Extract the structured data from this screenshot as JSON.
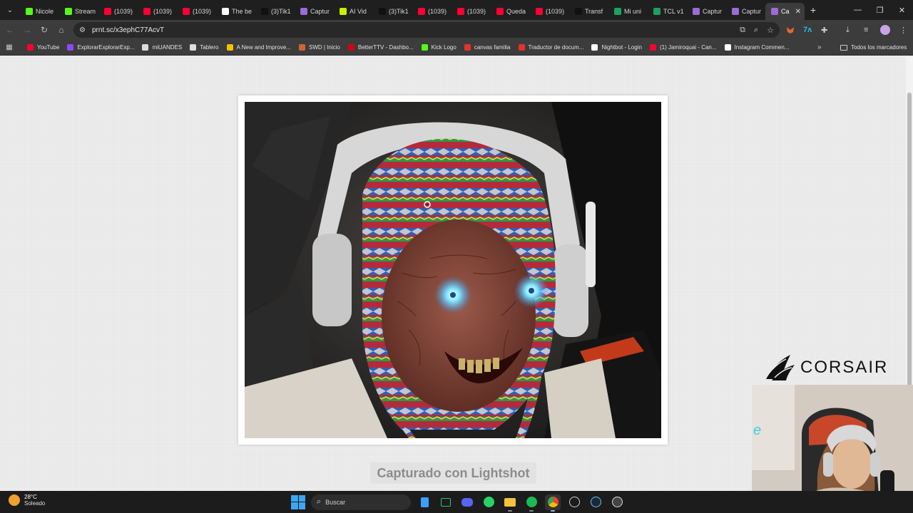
{
  "browser": {
    "tabs": [
      {
        "label": "Nicole",
        "color": "#53fc18"
      },
      {
        "label": "Stream",
        "color": "#53fc18"
      },
      {
        "label": "(1039)",
        "color": "#ff0033"
      },
      {
        "label": "(1039)",
        "color": "#ff0033"
      },
      {
        "label": "(1039)",
        "color": "#ff0033"
      },
      {
        "label": "The be",
        "color": "#ffffff"
      },
      {
        "label": "(3)Tik1",
        "color": "#111111"
      },
      {
        "label": "Captur",
        "color": "#9b6bd6"
      },
      {
        "label": "AI Vid",
        "color": "#c7f000"
      },
      {
        "label": "(3)Tik1",
        "color": "#111111"
      },
      {
        "label": "(1039)",
        "color": "#ff0033"
      },
      {
        "label": "(1039)",
        "color": "#ff0033"
      },
      {
        "label": "Queda",
        "color": "#ff0033"
      },
      {
        "label": "(1039)",
        "color": "#ff0033"
      },
      {
        "label": "Transf",
        "color": "#111111"
      },
      {
        "label": "Mi uni",
        "color": "#1aa260"
      },
      {
        "label": "TCL v1",
        "color": "#1aa260"
      },
      {
        "label": "Captur",
        "color": "#9b6bd6"
      },
      {
        "label": "Captur",
        "color": "#9b6bd6"
      },
      {
        "label": "Ca",
        "color": "#9b6bd6"
      }
    ],
    "new_tab": "+",
    "url": "prnt.sc/x3ephC77AcvT",
    "bookmarks": [
      {
        "label": "YouTube",
        "color": "#ff0033"
      },
      {
        "label": "ExplorarExplorarExp...",
        "color": "#9146ff"
      },
      {
        "label": "miUANDES",
        "color": "#dddddd"
      },
      {
        "label": "Tablero",
        "color": "#dddddd"
      },
      {
        "label": "A New and Improve...",
        "color": "#f2c200"
      },
      {
        "label": "SWD | Inicio",
        "color": "#cc6633"
      },
      {
        "label": "BetterTTV - Dashbo...",
        "color": "#d50014"
      },
      {
        "label": "Kick Logo",
        "color": "#53fc18"
      },
      {
        "label": "canvas familia",
        "color": "#e4332b"
      },
      {
        "label": "Traductor de docum...",
        "color": "#e4332b"
      },
      {
        "label": "Nightbot - Login",
        "color": "#ffffff"
      },
      {
        "label": "(1) Jamiroquai - Can...",
        "color": "#ff0033"
      },
      {
        "label": "Instagram Commen...",
        "color": "#ffffff"
      }
    ],
    "bookmarks_all": "Todos los marcadores"
  },
  "page": {
    "caption": "Capturado con Lightshot"
  },
  "overlay": {
    "brand": "CORSAIR"
  },
  "taskbar": {
    "temp": "28°C",
    "condition": "Soleado",
    "search_label": "Buscar"
  },
  "colors": {
    "chrome_dark": "#1f1f1f",
    "toolbar": "#3c3c3c",
    "page_bg": "#ededed",
    "accent_windows": "#3ea6f0"
  }
}
